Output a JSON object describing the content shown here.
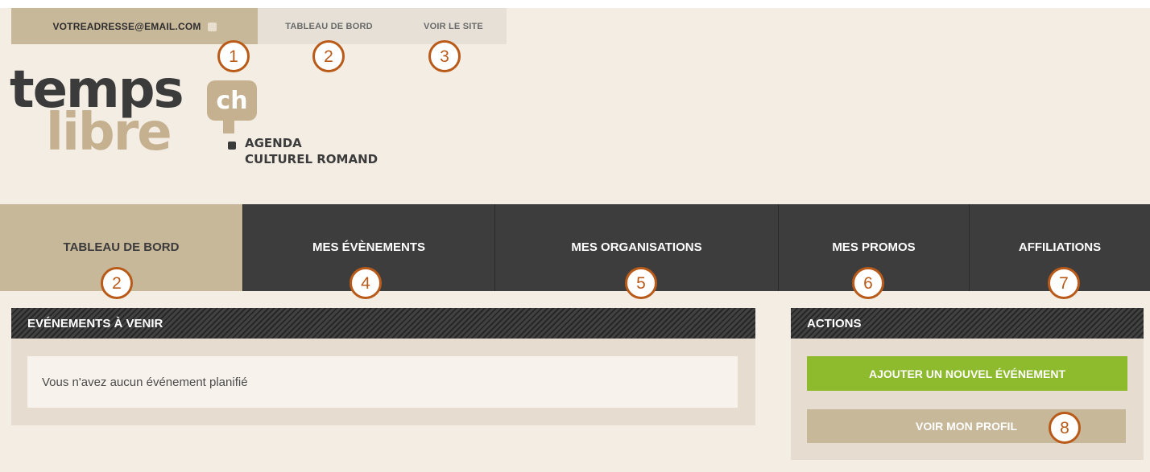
{
  "topbar": {
    "email": "VOTREADRESSE@EMAIL.COM",
    "external_icon": "external-link-icon",
    "dashboard_label": "TABLEAU DE BORD",
    "site_label": "VOIR LE SITE"
  },
  "logo": {
    "word1": "temps",
    "word2": "libre",
    "bubble": "ch",
    "tagline1": "AGENDA",
    "tagline2": "CULTUREL ROMAND"
  },
  "nav": {
    "items": [
      {
        "label": "TABLEAU DE BORD"
      },
      {
        "label": "MES ÉVÈNEMENTS"
      },
      {
        "label": "MES ORGANISATIONS"
      },
      {
        "label": "MES PROMOS"
      },
      {
        "label": "AFFILIATIONS"
      }
    ]
  },
  "events": {
    "title": "EVÉNEMENTS À VENIR",
    "empty_message": "Vous n'avez aucun événement planifié"
  },
  "actions": {
    "title": "ACTIONS",
    "add_event_label": "AJOUTER UN NOUVEL ÉVÉNEMENT",
    "profile_label": "VOIR MON PROFIL"
  },
  "badges": [
    "1",
    "2",
    "3",
    "2",
    "4",
    "5",
    "6",
    "7",
    "8"
  ],
  "colors": {
    "accent": "#c8b89a",
    "dark": "#3d3d3d",
    "green": "#8dbb2d",
    "badge": "#b95a18",
    "background": "#f3ede3"
  }
}
